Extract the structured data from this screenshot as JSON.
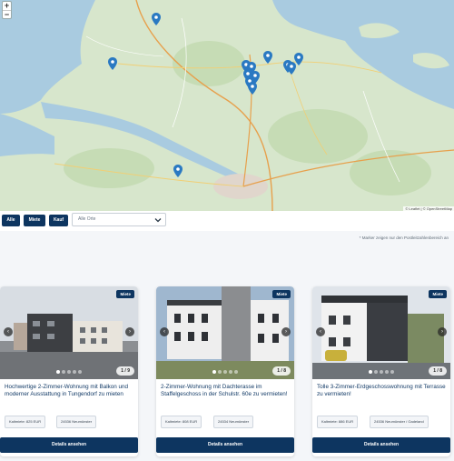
{
  "map": {
    "zoom_in": "+",
    "zoom_out": "−",
    "attribution": "© Leaflet | © OpenStreetMap",
    "marker_color": "#2a79c2"
  },
  "filters": {
    "buttons": [
      "Alle",
      "Miete",
      "Kauf"
    ],
    "location_select": "Alle Orte",
    "note": "* Marker zeigen nur den Postleitzahlenbereich an"
  },
  "colors": {
    "primary": "#0d3560",
    "title": "#123a66"
  },
  "listings": [
    {
      "badge": "Miete",
      "counter": "1 / 9",
      "title": "Hochwertige 2-Zimmer-Wohnung mit Balkon und moderner Ausstattung in Tungendorf zu mieten",
      "chips": [
        "Kaltmiete: 825 EUR",
        "24536 Neumünster"
      ],
      "cta": "Details ansehen"
    },
    {
      "badge": "Miete",
      "counter": "1 / 8",
      "title": "2-Zimmer-Wohnung mit Dachterasse im Staffelgeschoss in der Schulstr. 60e zu vermieten!",
      "chips": [
        "Kaltmiete: 808 EUR",
        "24534 Neumünster"
      ],
      "cta": "Details ansehen"
    },
    {
      "badge": "Miete",
      "counter": "1 / 8",
      "title": "Tolle 3-Zimmer-Erdgeschosswohnung mit Terrasse zu vermieten!",
      "chips": [
        "Kaltmiete: 886 EUR",
        "24536 Neumünster / Gadeland"
      ],
      "cta": "Details ansehen"
    }
  ]
}
